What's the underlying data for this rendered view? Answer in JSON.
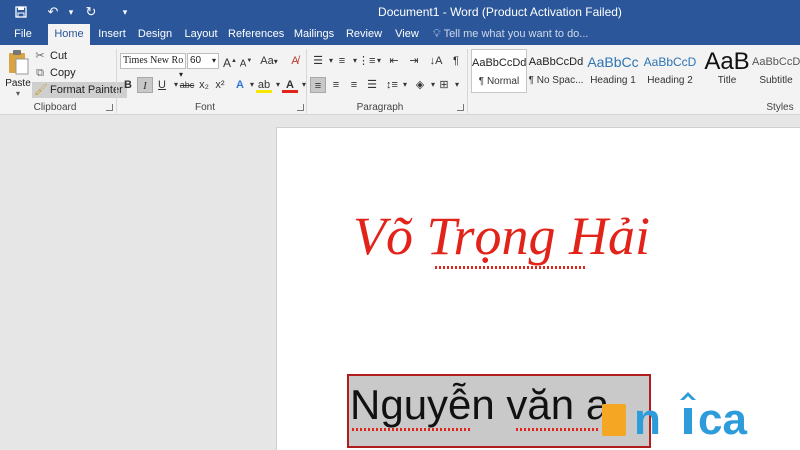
{
  "window": {
    "title": "Document1 - Word (Product Activation Failed)",
    "quick_access": [
      "save-icon",
      "undo-icon",
      "redo-icon",
      "customize-icon"
    ]
  },
  "tabs": [
    {
      "label": "File"
    },
    {
      "label": "Home"
    },
    {
      "label": "Insert"
    },
    {
      "label": "Design"
    },
    {
      "label": "Layout"
    },
    {
      "label": "References"
    },
    {
      "label": "Mailings"
    },
    {
      "label": "Review"
    },
    {
      "label": "View"
    }
  ],
  "active_tab": "Home",
  "tell_me": "Tell me what you want to do...",
  "clipboard": {
    "paste": "Paste",
    "cut": "Cut",
    "copy": "Copy",
    "format_painter": "Format Painter",
    "label": "Clipboard"
  },
  "font": {
    "name": "Times New Ro",
    "size": "60",
    "label": "Font",
    "bold": "B",
    "italic": "I",
    "underline": "U",
    "strike": "abc",
    "subscript": "x₂",
    "superscript": "x²",
    "case": "Aa",
    "grow": "A",
    "shrink": "A"
  },
  "paragraph": {
    "label": "Paragraph",
    "pilcrow": "¶"
  },
  "styles": {
    "label": "Styles",
    "items": [
      {
        "sample": "AaBbCcDd",
        "name": "¶ Normal"
      },
      {
        "sample": "AaBbCcDd",
        "name": "¶ No Spac..."
      },
      {
        "sample": "AaBbCc",
        "name": "Heading 1"
      },
      {
        "sample": "AaBbCcD",
        "name": "Heading 2"
      },
      {
        "sample": "AaB",
        "name": "Title"
      },
      {
        "sample": "AaBbCcD",
        "name": "Subtitle"
      }
    ]
  },
  "document": {
    "heading": "Võ Trọng Hải",
    "selected_text": "Nguyễn văn a"
  },
  "colors": {
    "accent": "#2b579a",
    "heading_red": "#e2231a",
    "selection_border": "#b11d1d",
    "logo_orange": "#f5a623",
    "logo_blue": "#2d9cdb"
  },
  "watermark": "unica"
}
